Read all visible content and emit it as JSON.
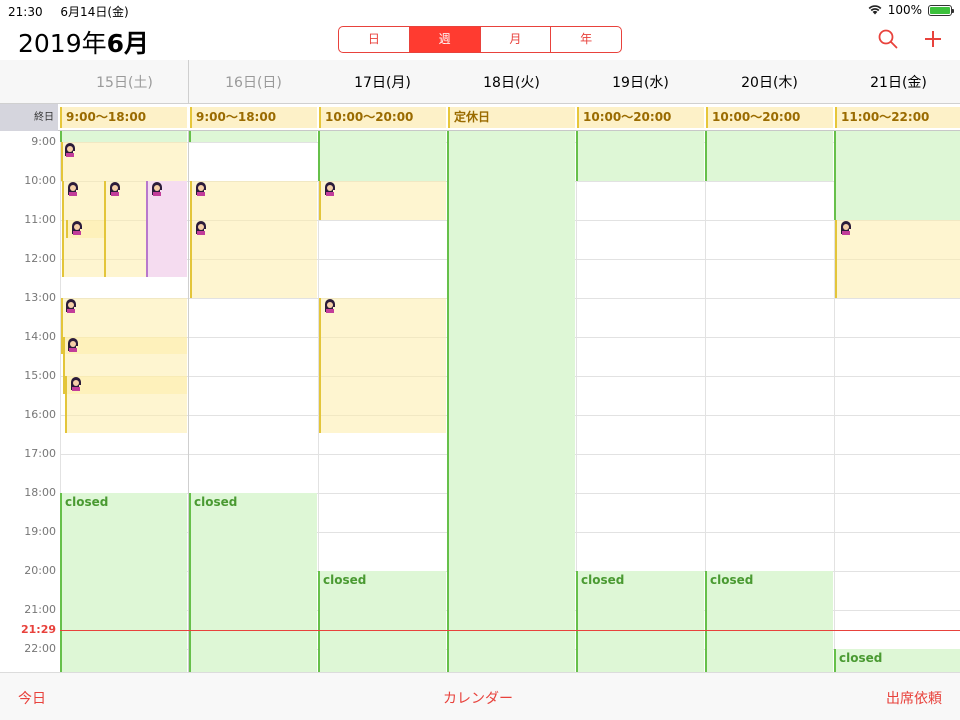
{
  "status": {
    "time": "21:30",
    "date": "6月14日(金)",
    "battery": "100%"
  },
  "header": {
    "year": "2019年",
    "month": "6月",
    "segments": [
      {
        "label": "日",
        "active": false
      },
      {
        "label": "週",
        "active": true
      },
      {
        "label": "月",
        "active": false
      },
      {
        "label": "年",
        "active": false
      }
    ]
  },
  "days": [
    "15日(土)",
    "16日(日)",
    "17日(月)",
    "18日(火)",
    "19日(水)",
    "20日(木)",
    "21日(金)"
  ],
  "allday_label": "終日",
  "allday_events": [
    "9:00〜18:00",
    "9:00〜18:00",
    "10:00〜20:00",
    "定休日",
    "10:00〜20:00",
    "10:00〜20:00",
    "11:00〜22:00"
  ],
  "hours": [
    "9:00",
    "10:00",
    "11:00",
    "12:00",
    "13:00",
    "14:00",
    "15:00",
    "16:00",
    "17:00",
    "18:00",
    "19:00",
    "20:00",
    "21:00",
    "22:00"
  ],
  "closed_label": "closed",
  "now_label": "21:29",
  "bottom": {
    "today": "今日",
    "calendar": "カレンダー",
    "request": "出席依頼"
  },
  "colors": {
    "accent": "#e8423c",
    "closed_bg": "#def7d6",
    "booking_bg": "#fdf1c8"
  }
}
